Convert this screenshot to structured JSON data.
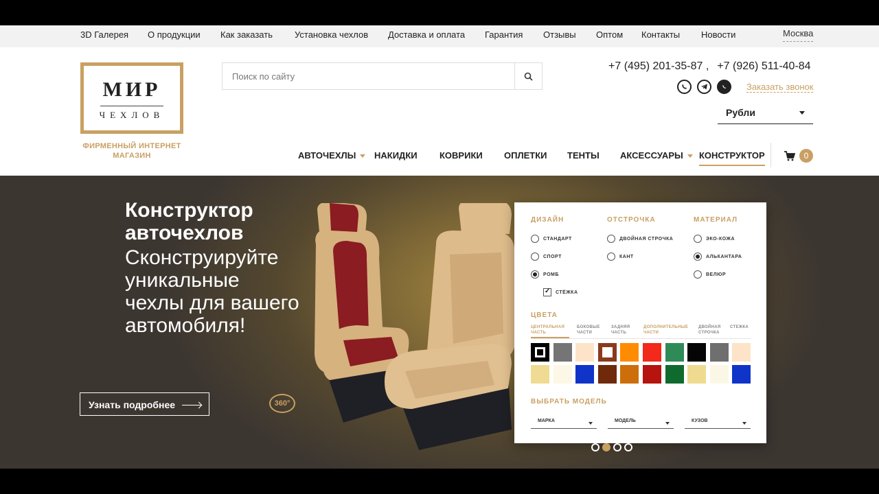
{
  "topnav": {
    "items": [
      "3D Галерея",
      "О продукции",
      "Как заказать",
      "Установка чехлов",
      "Доставка и оплата",
      "Гарантия",
      "Отзывы",
      "Оптом",
      "Контакты",
      "Новости"
    ],
    "city": "Москва"
  },
  "logo": {
    "main": "МИР",
    "sub": "ЧЕХЛОВ",
    "tagline": "ФИРМЕННЫЙ ИНТЕРНЕТ МАГАЗИН"
  },
  "search": {
    "placeholder": "Поиск по сайту"
  },
  "contacts": {
    "phone1": "+7 (495) 201-35-87 ,",
    "phone2": "+7 (926) 511-40-84",
    "callback": "Заказать звонок"
  },
  "currency": {
    "selected": "Рубли"
  },
  "mainnav": {
    "items": [
      "АВТОЧЕХЛЫ",
      "НАКИДКИ",
      "КОВРИКИ",
      "ОПЛЕТКИ",
      "ТЕНТЫ",
      "АКСЕССУАРЫ",
      "КОНСТРУКТОР"
    ],
    "cart_count": "0"
  },
  "hero": {
    "title_line1": "Конструктор",
    "title_line2": "авточехлов",
    "subtitle": "Сконструируйте уникальные чехлы для вашего автомобиля!",
    "button": "Узнать подробнее",
    "badge360": "360°"
  },
  "configurator": {
    "design_title": "ДИЗАЙН",
    "design_options": [
      "СТАНДАРТ",
      "СПОРТ",
      "РОМБ"
    ],
    "stitch_check": "СТЁЖКА",
    "stitching_title": "ОТСТРОЧКА",
    "stitching_options": [
      "ДВОЙНАЯ СТРОЧКА",
      "КАНТ"
    ],
    "material_title": "МАТЕРИАЛ",
    "material_options": [
      "ЭКО-КОЖА",
      "АЛЬКАНТАРА",
      "ВЕЛЮР"
    ],
    "colors_title": "ЦВЕТА",
    "color_tabs": [
      "ЦЕНТРАЛЬНАЯ ЧАСТЬ",
      "БОКОВЫЕ ЧАСТИ",
      "ЗАДНЯЯ ЧАСТЬ",
      "ДОПОЛНИТЕЛЬНЫЕ ЧАСТИ",
      "ДВОЙНАЯ СТРОЧКА",
      "СТЕЖКА"
    ],
    "swatches_row1": [
      "#000000",
      "#757575",
      "#fde3c8",
      "#8b3a1e",
      "#ff8c00",
      "#f2291b",
      "#2e8b57",
      "#050505",
      "#6f6f6f",
      "#fde3c8"
    ],
    "swatches_row2": [
      "#efdb92",
      "#fdf8e6",
      "#1034c8",
      "#6f2a0c",
      "#cc6f0a",
      "#b5150e",
      "#0f6a2e",
      "#efdb8f",
      "#fbf7e6",
      "#1034c8"
    ],
    "model_title": "ВЫБРАТЬ МОДЕЛЬ",
    "model_fields": [
      "МАРКА",
      "МОДЕЛЬ",
      "КУЗОВ"
    ]
  },
  "colors": {
    "accent": "#c9a063",
    "dark": "#222222",
    "topbar_bg": "#f2f2f2"
  }
}
